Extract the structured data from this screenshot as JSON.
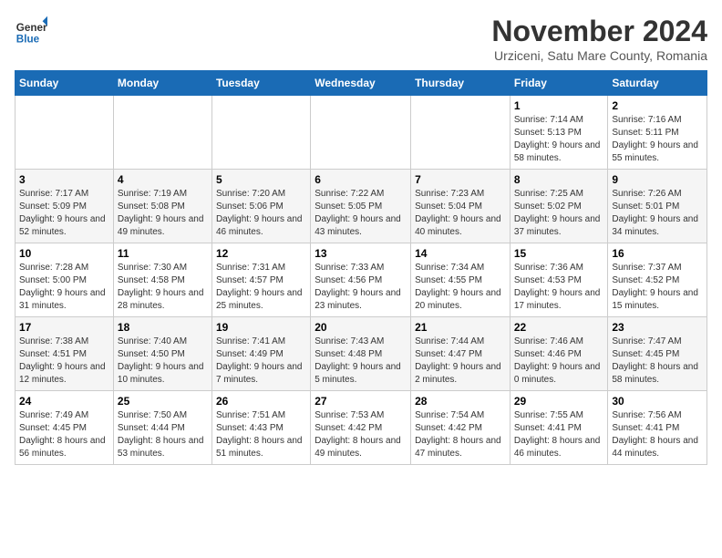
{
  "logo": {
    "line1": "General",
    "line2": "Blue"
  },
  "title": "November 2024",
  "location": "Urziceni, Satu Mare County, Romania",
  "days_of_week": [
    "Sunday",
    "Monday",
    "Tuesday",
    "Wednesday",
    "Thursday",
    "Friday",
    "Saturday"
  ],
  "weeks": [
    [
      {
        "day": "",
        "info": ""
      },
      {
        "day": "",
        "info": ""
      },
      {
        "day": "",
        "info": ""
      },
      {
        "day": "",
        "info": ""
      },
      {
        "day": "",
        "info": ""
      },
      {
        "day": "1",
        "info": "Sunrise: 7:14 AM\nSunset: 5:13 PM\nDaylight: 9 hours and 58 minutes."
      },
      {
        "day": "2",
        "info": "Sunrise: 7:16 AM\nSunset: 5:11 PM\nDaylight: 9 hours and 55 minutes."
      }
    ],
    [
      {
        "day": "3",
        "info": "Sunrise: 7:17 AM\nSunset: 5:09 PM\nDaylight: 9 hours and 52 minutes."
      },
      {
        "day": "4",
        "info": "Sunrise: 7:19 AM\nSunset: 5:08 PM\nDaylight: 9 hours and 49 minutes."
      },
      {
        "day": "5",
        "info": "Sunrise: 7:20 AM\nSunset: 5:06 PM\nDaylight: 9 hours and 46 minutes."
      },
      {
        "day": "6",
        "info": "Sunrise: 7:22 AM\nSunset: 5:05 PM\nDaylight: 9 hours and 43 minutes."
      },
      {
        "day": "7",
        "info": "Sunrise: 7:23 AM\nSunset: 5:04 PM\nDaylight: 9 hours and 40 minutes."
      },
      {
        "day": "8",
        "info": "Sunrise: 7:25 AM\nSunset: 5:02 PM\nDaylight: 9 hours and 37 minutes."
      },
      {
        "day": "9",
        "info": "Sunrise: 7:26 AM\nSunset: 5:01 PM\nDaylight: 9 hours and 34 minutes."
      }
    ],
    [
      {
        "day": "10",
        "info": "Sunrise: 7:28 AM\nSunset: 5:00 PM\nDaylight: 9 hours and 31 minutes."
      },
      {
        "day": "11",
        "info": "Sunrise: 7:30 AM\nSunset: 4:58 PM\nDaylight: 9 hours and 28 minutes."
      },
      {
        "day": "12",
        "info": "Sunrise: 7:31 AM\nSunset: 4:57 PM\nDaylight: 9 hours and 25 minutes."
      },
      {
        "day": "13",
        "info": "Sunrise: 7:33 AM\nSunset: 4:56 PM\nDaylight: 9 hours and 23 minutes."
      },
      {
        "day": "14",
        "info": "Sunrise: 7:34 AM\nSunset: 4:55 PM\nDaylight: 9 hours and 20 minutes."
      },
      {
        "day": "15",
        "info": "Sunrise: 7:36 AM\nSunset: 4:53 PM\nDaylight: 9 hours and 17 minutes."
      },
      {
        "day": "16",
        "info": "Sunrise: 7:37 AM\nSunset: 4:52 PM\nDaylight: 9 hours and 15 minutes."
      }
    ],
    [
      {
        "day": "17",
        "info": "Sunrise: 7:38 AM\nSunset: 4:51 PM\nDaylight: 9 hours and 12 minutes."
      },
      {
        "day": "18",
        "info": "Sunrise: 7:40 AM\nSunset: 4:50 PM\nDaylight: 9 hours and 10 minutes."
      },
      {
        "day": "19",
        "info": "Sunrise: 7:41 AM\nSunset: 4:49 PM\nDaylight: 9 hours and 7 minutes."
      },
      {
        "day": "20",
        "info": "Sunrise: 7:43 AM\nSunset: 4:48 PM\nDaylight: 9 hours and 5 minutes."
      },
      {
        "day": "21",
        "info": "Sunrise: 7:44 AM\nSunset: 4:47 PM\nDaylight: 9 hours and 2 minutes."
      },
      {
        "day": "22",
        "info": "Sunrise: 7:46 AM\nSunset: 4:46 PM\nDaylight: 9 hours and 0 minutes."
      },
      {
        "day": "23",
        "info": "Sunrise: 7:47 AM\nSunset: 4:45 PM\nDaylight: 8 hours and 58 minutes."
      }
    ],
    [
      {
        "day": "24",
        "info": "Sunrise: 7:49 AM\nSunset: 4:45 PM\nDaylight: 8 hours and 56 minutes."
      },
      {
        "day": "25",
        "info": "Sunrise: 7:50 AM\nSunset: 4:44 PM\nDaylight: 8 hours and 53 minutes."
      },
      {
        "day": "26",
        "info": "Sunrise: 7:51 AM\nSunset: 4:43 PM\nDaylight: 8 hours and 51 minutes."
      },
      {
        "day": "27",
        "info": "Sunrise: 7:53 AM\nSunset: 4:42 PM\nDaylight: 8 hours and 49 minutes."
      },
      {
        "day": "28",
        "info": "Sunrise: 7:54 AM\nSunset: 4:42 PM\nDaylight: 8 hours and 47 minutes."
      },
      {
        "day": "29",
        "info": "Sunrise: 7:55 AM\nSunset: 4:41 PM\nDaylight: 8 hours and 46 minutes."
      },
      {
        "day": "30",
        "info": "Sunrise: 7:56 AM\nSunset: 4:41 PM\nDaylight: 8 hours and 44 minutes."
      }
    ]
  ]
}
